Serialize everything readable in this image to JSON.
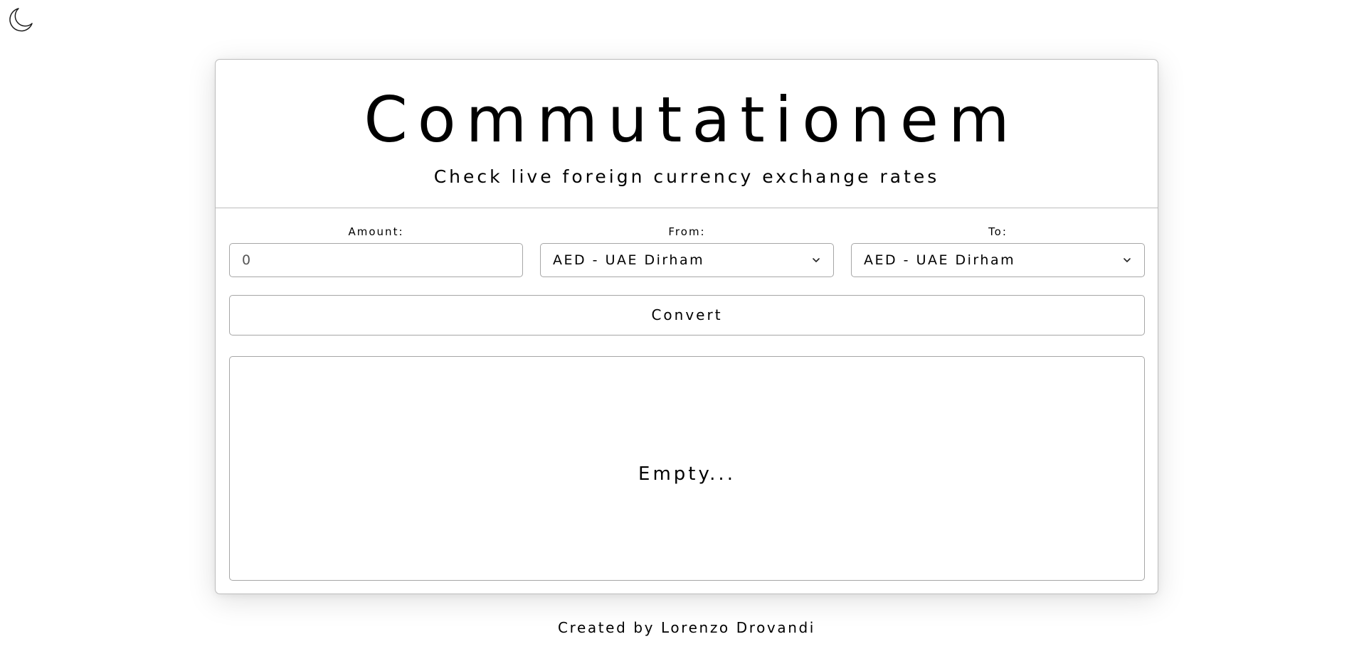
{
  "theme_toggle": {
    "icon": "moon-icon"
  },
  "header": {
    "title": "Commutationem",
    "subtitle": "Check live foreign currency exchange rates"
  },
  "form": {
    "amount": {
      "label": "Amount:",
      "value": "0"
    },
    "from": {
      "label": "From:",
      "selected": "AED - UAE Dirham"
    },
    "to": {
      "label": "To:",
      "selected": "AED - UAE Dirham"
    },
    "convert_label": "Convert"
  },
  "result": {
    "text": "Empty..."
  },
  "footer": {
    "text": "Created by Lorenzo Drovandi"
  },
  "colors": {
    "border": "#bdbdbd",
    "text": "#000000",
    "background": "#ffffff"
  }
}
